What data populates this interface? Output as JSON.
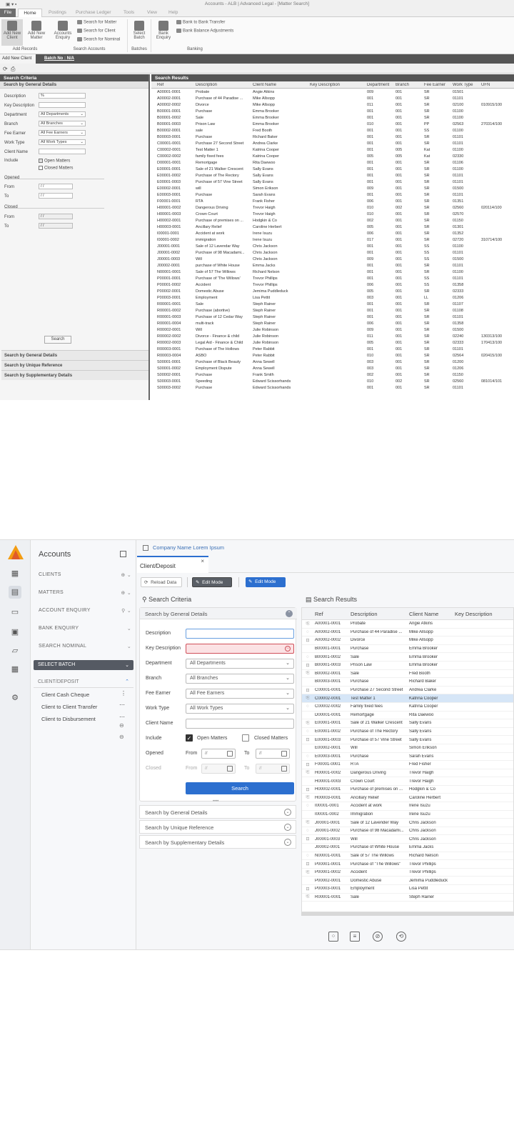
{
  "old": {
    "title": "Accounts - ALB | Advanced Legal - [Matter Search]",
    "menu": [
      "File",
      "Home",
      "Postings",
      "Purchase Ledger",
      "Tools",
      "View",
      "Help"
    ],
    "ribbon": {
      "add_new_client": "Add New Client",
      "add_new_matter": "Add New Matter",
      "accounts_enquiry": "Accounts Enquiry",
      "search_matter": "Search for Matter",
      "search_client": "Search for Client",
      "search_nominal": "Search for Nominal",
      "select_batch": "Select Batch",
      "bank_enquiry": "Bank Enquiry",
      "bank_transfer": "Bank to Bank Transfer",
      "bank_adjust": "Bank Balance Adjustments",
      "grp_add": "Add Records",
      "grp_search": "Search Accounts",
      "grp_batches": "Batches",
      "grp_banking": "Banking"
    },
    "tab_label": "Add New Client",
    "batch_label": "Batch No : N/A",
    "search_criteria": "Search Criteria",
    "general_details": "Search by General Details",
    "labels": {
      "description": "Description",
      "key_description": "Key Description",
      "department": "Department",
      "branch": "Branch",
      "fee_earner": "Fee Earner",
      "work_type": "Work Type",
      "client_name": "Client Name",
      "include": "Include",
      "open_matters": "Open Matters",
      "closed_matters": "Closed Matters",
      "opened": "Opened",
      "closed": "Closed",
      "from": "From",
      "to": "To"
    },
    "values": {
      "description": "%",
      "department": "All Departments",
      "branch": "All Branches",
      "fee_earner": "All Fee Earners",
      "work_type": "All Work Types",
      "date_placeholder": "/ /"
    },
    "search_btn": "Search",
    "acc": [
      "Search by General Details",
      "Search by Unique Reference",
      "Search by Supplementary Details"
    ],
    "results_title": "Search Results",
    "columns": [
      "Ref",
      "Description",
      "Client Name",
      "Key Description",
      "Department",
      "Branch",
      "Fee Earner",
      "Work Type",
      "UFN"
    ],
    "rows": [
      [
        "A00001-0001",
        "Probate",
        "Angie Atkins",
        "",
        "009",
        "001",
        "SR",
        "01501",
        ""
      ],
      [
        "A00002-0001",
        "Purchase of 44 Paradise ...",
        "Mike Allsopp",
        "",
        "001",
        "001",
        "SR",
        "01101",
        ""
      ],
      [
        "A00002-0002",
        "Divorce",
        "Mike Allsopp",
        "",
        "011",
        "001",
        "SR",
        "02100",
        "010915/100"
      ],
      [
        "B00001-0001",
        "Purchase",
        "Emma Brooker",
        "",
        "001",
        "001",
        "SR",
        "01100",
        ""
      ],
      [
        "B00001-0002",
        "Sale",
        "Emma Brooker",
        "",
        "001",
        "001",
        "SR",
        "01100",
        ""
      ],
      [
        "B00001-0003",
        "Prison Law",
        "Emma Brooker",
        "",
        "010",
        "001",
        "PP",
        "02563",
        "270314/100"
      ],
      [
        "B00002-0001",
        "sale",
        "Fred Booth",
        "",
        "001",
        "001",
        "SS",
        "01100",
        ""
      ],
      [
        "B00003-0001",
        "Purchase",
        "Richard Baker",
        "",
        "001",
        "001",
        "SR",
        "01101",
        ""
      ],
      [
        "C00001-0001",
        "Purchase 27 Second Street",
        "Andrea Clarke",
        "",
        "001",
        "001",
        "SR",
        "01101",
        ""
      ],
      [
        "C00002-0001",
        "Test Matter 1",
        "Katrina Cooper",
        "",
        "001",
        "005",
        "Kat",
        "01100",
        ""
      ],
      [
        "C00002-0002",
        "family fixed fees",
        "Katrina Cooper",
        "",
        "005",
        "005",
        "Kat",
        "02330",
        ""
      ],
      [
        "D00001-0001",
        "Remortgage",
        "Rita Daewoo",
        "",
        "001",
        "001",
        "SR",
        "01106",
        ""
      ],
      [
        "E00001-0001",
        "Sale of 21 Walker Crescent",
        "Sally Evans",
        "",
        "001",
        "001",
        "SR",
        "01100",
        ""
      ],
      [
        "E00001-0002",
        "Purchase of The Rectory",
        "Sally Evans",
        "",
        "001",
        "001",
        "SR",
        "01101",
        ""
      ],
      [
        "E00001-0003",
        "Purchase of 57 Vine Street",
        "Sally Evans",
        "",
        "001",
        "001",
        "SR",
        "01101",
        ""
      ],
      [
        "E00002-0001",
        "will",
        "Simon Erikson",
        "",
        "009",
        "001",
        "SR",
        "01500",
        ""
      ],
      [
        "E00003-0001",
        "Purchase",
        "Sarah Evans",
        "",
        "001",
        "001",
        "SR",
        "01101",
        ""
      ],
      [
        "F00001-0001",
        "RTA",
        "Frank Fisher",
        "",
        "006",
        "001",
        "SR",
        "01351",
        ""
      ],
      [
        "H00001-0002",
        "Dangerous Driving",
        "Trevor Haigh",
        "",
        "010",
        "002",
        "SR",
        "02560",
        "020114/100"
      ],
      [
        "H00001-0003",
        "Crown Court",
        "Trevor Haigh",
        "",
        "010",
        "001",
        "SR",
        "02570",
        ""
      ],
      [
        "H00002-0001",
        "Purchase of premises on ...",
        "Hodgkin & Co",
        "",
        "002",
        "001",
        "SR",
        "01150",
        ""
      ],
      [
        "H00003-0001",
        "Ancillary Relief",
        "Caroline Herbert",
        "",
        "005",
        "001",
        "SR",
        "01301",
        ""
      ],
      [
        "I00001-0001",
        "Accident at work",
        "Irene Isuzu",
        "",
        "006",
        "001",
        "SR",
        "01352",
        ""
      ],
      [
        "I00001-0002",
        "immigration",
        "Irene Isuzu",
        "",
        "017",
        "001",
        "SR",
        "02720",
        "310714/100"
      ],
      [
        "J00001-0001",
        "Sale of 12 Lavendar Way",
        "Chris Jackson",
        "",
        "001",
        "001",
        "SS",
        "01100",
        ""
      ],
      [
        "J00001-0002",
        "Purchase of 98 Macadami...",
        "Chris Jackson",
        "",
        "001",
        "001",
        "SS",
        "01101",
        ""
      ],
      [
        "J00001-0003",
        "Will",
        "Chris Jackson",
        "",
        "009",
        "001",
        "SS",
        "01500",
        ""
      ],
      [
        "J00002-0001",
        "purchase of White House",
        "Emma Jacks",
        "",
        "001",
        "001",
        "SR",
        "01101",
        ""
      ],
      [
        "N00001-0001",
        "Sale of 57 The Willows",
        "Richard Nelson",
        "",
        "001",
        "001",
        "SR",
        "01100",
        ""
      ],
      [
        "P00001-0001",
        "Purchase of 'The Willows'",
        "Trevor Phillips",
        "",
        "001",
        "001",
        "SS",
        "01101",
        ""
      ],
      [
        "P00001-0002",
        "Accident",
        "Trevor Phillips",
        "",
        "006",
        "001",
        "SS",
        "01358",
        ""
      ],
      [
        "P00002-0001",
        "Domestic Abuse",
        "Jemima Puddleduck",
        "",
        "005",
        "001",
        "SR",
        "02333",
        ""
      ],
      [
        "P00003-0001",
        "Employment",
        "Lisa Pettit",
        "",
        "003",
        "001",
        "LL",
        "01206",
        ""
      ],
      [
        "R00001-0001",
        "Sale",
        "Steph Rainer",
        "",
        "001",
        "001",
        "SR",
        "01107",
        ""
      ],
      [
        "R00001-0002",
        "Purchase (abortive)",
        "Steph Rainer",
        "",
        "001",
        "001",
        "SR",
        "01108",
        ""
      ],
      [
        "R00001-0003",
        "Purchase of 12 Cedar Way",
        "Steph Rainer",
        "",
        "001",
        "001",
        "SR",
        "01101",
        ""
      ],
      [
        "R00001-0004",
        "multi-track",
        "Steph Rainer",
        "",
        "006",
        "001",
        "SR",
        "01358",
        ""
      ],
      [
        "R00002-0001",
        "Will",
        "Julie Robinson",
        "",
        "009",
        "001",
        "SR",
        "01500",
        ""
      ],
      [
        "R00002-0002",
        "Divorce - Finance & child",
        "Julie Robinson",
        "",
        "011",
        "001",
        "SR",
        "02240",
        "130313/100"
      ],
      [
        "R00002-0003",
        "Legal Aid - Finance & Child",
        "Julie Robinson",
        "",
        "005",
        "001",
        "SR",
        "02333",
        "170413/100"
      ],
      [
        "R00003-0001",
        "Purchase of The Hollows",
        "Peter Rabbit",
        "",
        "001",
        "001",
        "SR",
        "01101",
        ""
      ],
      [
        "R00003-0004",
        "ASBO",
        "Peter Rabbit",
        "",
        "010",
        "001",
        "SR",
        "02564",
        "020415/100"
      ],
      [
        "S00001-0001",
        "Purchase of Black Beauty",
        "Anna Sewell",
        "",
        "003",
        "001",
        "SR",
        "01200",
        ""
      ],
      [
        "S00001-0002",
        "Employment Dispute",
        "Anna Sewell",
        "",
        "003",
        "001",
        "SR",
        "01206",
        ""
      ],
      [
        "S00002-0001",
        "Purchase",
        "Frank Smith",
        "",
        "002",
        "001",
        "SR",
        "01150",
        ""
      ],
      [
        "S00003-0001",
        "Speeding",
        "Edward Scissorhands",
        "",
        "010",
        "002",
        "SR",
        "02560",
        "081014/101"
      ],
      [
        "S00003-0002",
        "Purchase",
        "Edward Scissorhands",
        "",
        "001",
        "001",
        "SR",
        "01101",
        ""
      ]
    ]
  },
  "new": {
    "app_title": "Accounts",
    "nav": [
      {
        "label": "CLIENTS",
        "ctl": "⊕ ⌄"
      },
      {
        "label": "MATTERS",
        "ctl": "⊕ ⌄"
      },
      {
        "label": "ACCOUNT ENQUIRY",
        "ctl": "⚲ ⌄"
      },
      {
        "label": "BANK ENQUIRY",
        "ctl": "⌄"
      },
      {
        "label": "SEARCH NOMINAL",
        "ctl": "⌄"
      }
    ],
    "select_batch": "SELECT BATCH",
    "client_deposit_nav": "CLIENT/DEPOSIT",
    "sub_items": [
      "Client Cash Cheque",
      "Client to Client Transfer",
      "Client to Disbursement"
    ],
    "company": "Company Name Lorem Ipsum",
    "tab": "Client/Deposit",
    "reload": "Reload Data",
    "edit_mode": "Edit Mode",
    "search_criteria": "Search Criteria",
    "search_results": "Search Results",
    "general_details": "Search by General Details",
    "labels": {
      "description": "Description",
      "key_description": "Key Description",
      "department": "Department",
      "branch": "Branch",
      "fee_earner": "Fee Earner",
      "work_type": "Work Type",
      "client_name": "Client Name",
      "include": "Include",
      "open_matters": "Open Matters",
      "closed_matters": "Closed Matters",
      "opened": "Opened",
      "closed": "Closed",
      "from": "From",
      "to": "To"
    },
    "values": {
      "department": "All Departments",
      "branch": "All Branches",
      "fee_earner": "All Fee Earners",
      "work_type": "All Work Types",
      "date_placeholder": "//"
    },
    "search_btn": "Search",
    "acc": [
      "Search by General Details",
      "Search by Unique Reference",
      "Search by Supplementary Details"
    ],
    "columns": [
      "Ref",
      "Description",
      "Client Name",
      "Key Description"
    ],
    "rows": [
      [
        "A00001-0001",
        "Probate",
        "Angie Atkins"
      ],
      [
        "A00002-0001",
        "Purchase of 44 Paradise ...",
        "Mike Allsopp"
      ],
      [
        "A00002-0002",
        "Divorce",
        "Mike Allsopp"
      ],
      [
        "B00001-0001",
        "Purchase",
        "Emma Brooker"
      ],
      [
        "B00001-0002",
        "Sale",
        "Emma Brooker"
      ],
      [
        "B00001-0003",
        "Prison Law",
        "Emma Brooker"
      ],
      [
        "B00002-0001",
        "Sale",
        "Fred Booth"
      ],
      [
        "B00003-0001",
        "Purchase",
        "Richard Baker"
      ],
      [
        "C00001-0001",
        "Purchase 27 Second Street",
        "Andrea Clarke"
      ],
      [
        "C00002-0001",
        "Test Matter 1",
        "Katrina Cooper"
      ],
      [
        "C00002-0002",
        "Family fixed fees",
        "Katrina Cooper"
      ],
      [
        "D00001-0001",
        "Remortgage",
        "Rita Daewoo"
      ],
      [
        "E00001-0001",
        "Sale of 21 Walker Crescent",
        "Sally Evans"
      ],
      [
        "E00001-0002",
        "Purchase of The Rectory",
        "Sally Evans"
      ],
      [
        "E00001-0003",
        "Purchase of 57 Vine Street",
        "Sally Evans"
      ],
      [
        "E00002-0001",
        "Will",
        "Simon Erikson"
      ],
      [
        "E00003-0001",
        "Purchase",
        "Sarah Evans"
      ],
      [
        "F00001-0001",
        "RTA",
        "Fred Fisher"
      ],
      [
        "H00001-0002",
        "Dangerous Driving",
        "Trevor Haigh"
      ],
      [
        "H00001-0003",
        "Crown Court",
        "Trevor Haigh"
      ],
      [
        "H00002-0001",
        "Purchase of premises on ...",
        "Hodgkin & Co"
      ],
      [
        "H00003-0001",
        "Ancillary Relief",
        "Caroline Herbert"
      ],
      [
        "I00001-0001",
        "Accident at work",
        "Irene Isuzu"
      ],
      [
        "I00001-0002",
        "Immigration",
        "Irene Isuzu"
      ],
      [
        "J00001-0001",
        "Sale of 12 Lavender Way",
        "Chris Jackson"
      ],
      [
        "J00001-0002",
        "Purchase of 98 Macadami...",
        "Chris Jackson"
      ],
      [
        "J00001-0003",
        "Will",
        "Chris Jackson"
      ],
      [
        "J00002-0001",
        "Purchase of White House",
        "Emma Jacks"
      ],
      [
        "N00001-0001",
        "Sale of 57 The Willows",
        "Richard Nelson"
      ],
      [
        "P00001-0001",
        "Purchase of \"The Willows\"",
        "Trevor Phillips"
      ],
      [
        "P00001-0002",
        "Accident",
        "Trevor Phillips"
      ],
      [
        "P00002-0001",
        "Domestic Abuse",
        "Jemima Puddleduck"
      ],
      [
        "P00003-0001",
        "Employment",
        "Lisa Pettit"
      ],
      [
        "R00001-0001",
        "Sale",
        "Steph Rainer"
      ]
    ],
    "highlight_ref": "C00002-0001"
  }
}
